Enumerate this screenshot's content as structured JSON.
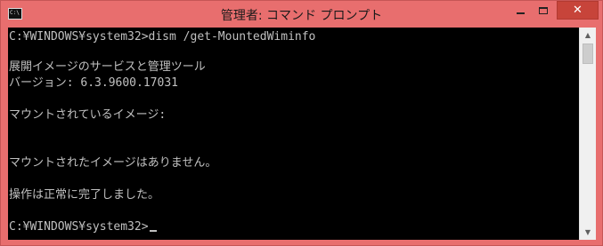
{
  "window": {
    "title": "管理者: コマンド プロンプト",
    "app_icon": "command-prompt-icon",
    "app_icon_text": "C:\\",
    "controls": {
      "minimize": "minimize-icon",
      "maximize": "maximize-icon",
      "close": "close-icon",
      "close_glyph": "✕"
    },
    "accent_color": "#e86e6e",
    "close_color": "#c7443a"
  },
  "console": {
    "lines": [
      "C:¥WINDOWS¥system32>dism /get-MountedWiminfo",
      "",
      "展開イメージのサービスと管理ツール",
      "バージョン: 6.3.9600.17031",
      "",
      "マウントされているイメージ:",
      "",
      "",
      "マウントされたイメージはありません。",
      "",
      "操作は正常に完了しました。",
      "",
      "C:¥WINDOWS¥system32>"
    ],
    "text_color": "#c0c0c0",
    "background": "#000000"
  },
  "scrollbar": {
    "up_glyph": "▲",
    "down_glyph": "▼"
  }
}
